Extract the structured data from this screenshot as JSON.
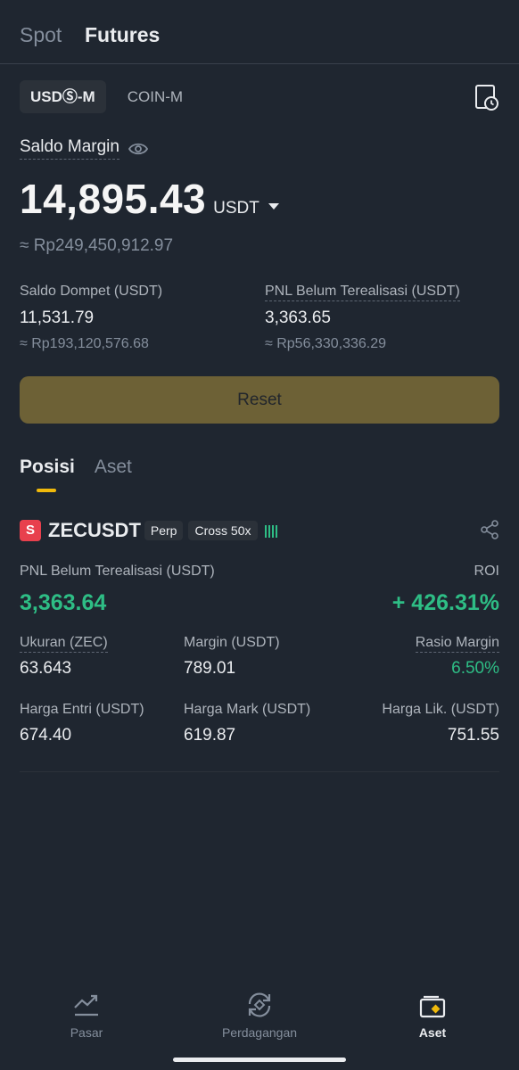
{
  "topnav": {
    "spot": "Spot",
    "futures": "Futures"
  },
  "segment": {
    "usdm": "USDⓈ-M",
    "coinm": "COIN-M"
  },
  "balance": {
    "label": "Saldo Margin",
    "value": "14,895.43",
    "unit": "USDT",
    "idr": "≈ Rp249,450,912.97"
  },
  "wallet": {
    "label": "Saldo Dompet (USDT)",
    "value": "11,531.79",
    "idr": "≈ Rp193,120,576.68"
  },
  "unrealized": {
    "label": "PNL Belum Terealisasi (USDT)",
    "value": "3,363.65",
    "idr": "≈ Rp56,330,336.29"
  },
  "reset_label": "Reset",
  "position_tabs": {
    "positions": "Posisi",
    "assets": "Aset"
  },
  "position": {
    "badge": "S",
    "symbol": "ZECUSDT",
    "chip_type": "Perp",
    "chip_margin": "Cross 50x",
    "pnl_label": "PNL Belum Terealisasi (USDT)",
    "pnl_value": "3,363.64",
    "roi_label": "ROI",
    "roi_value": "+ 426.31%",
    "size_label": "Ukuran (ZEC)",
    "size_value": "63.643",
    "margin_label": "Margin (USDT)",
    "margin_value": "789.01",
    "margin_ratio_label": "Rasio Margin",
    "margin_ratio_value": "6.50%",
    "entry_label": "Harga Entri (USDT)",
    "entry_value": "674.40",
    "mark_label": "Harga Mark (USDT)",
    "mark_value": "619.87",
    "liq_label": "Harga Lik. (USDT)",
    "liq_value": "751.55"
  },
  "bottomnav": {
    "markets": "Pasar",
    "trade": "Perdagangan",
    "assets": "Aset"
  },
  "colors": {
    "bg": "#1f2630",
    "green": "#2ebd85",
    "red_badge": "#e8404d",
    "accent": "#f0b90b",
    "reset_btn": "#6d6136"
  }
}
